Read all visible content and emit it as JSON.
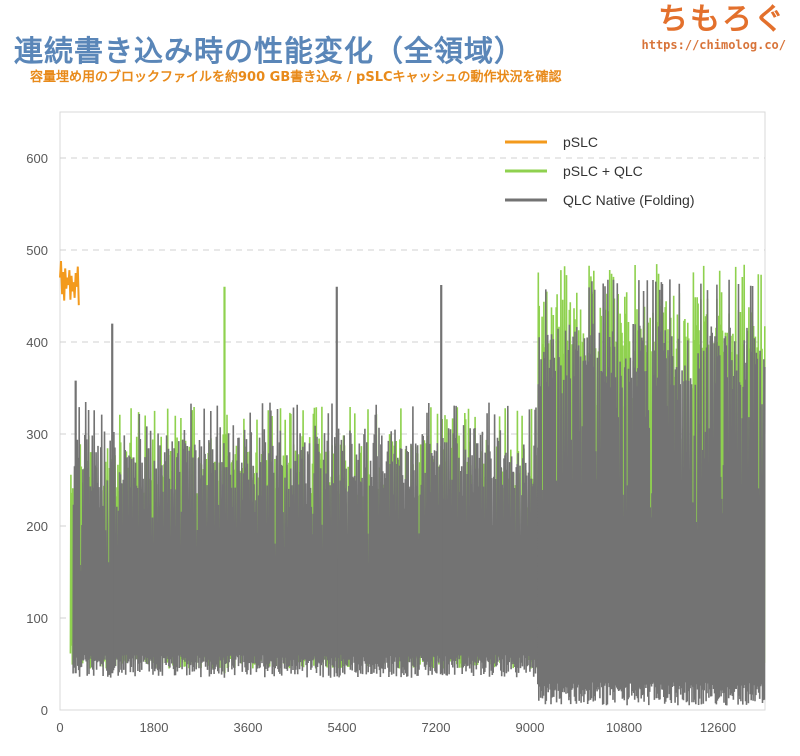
{
  "header": {
    "title": "連続書き込み時の性能変化（全領域）",
    "subtitle": "容量埋め用のブロックファイルを約900 GB書き込み / pSLCキャッシュの動作状況を確認",
    "brand_name": "ちもろぐ",
    "brand_url": "https://chimolog.co/"
  },
  "chart_data": {
    "type": "line",
    "title": "連続書き込み時の性能変化（全領域）",
    "subtitle": "容量埋め用のブロックファイルを約900 GB書き込み / pSLCキャッシュの動作状況を確認",
    "xlabel": "",
    "ylabel": "",
    "xlim": [
      0,
      13500
    ],
    "ylim": [
      0,
      650
    ],
    "x_ticks": [
      0,
      1800,
      3600,
      5400,
      7200,
      9000,
      10800,
      12600
    ],
    "y_ticks": [
      0,
      100,
      200,
      300,
      400,
      500,
      600
    ],
    "grid": "horizontal dashed",
    "legend_position": "top-right",
    "colors": {
      "pslc": "#f39a1d",
      "pslc_qlc": "#8fd14f",
      "qlc_native": "#737373",
      "grid": "#d0d0d0",
      "axis_text": "#595959"
    },
    "series": [
      {
        "name": "pSLC",
        "color": "#f39a1d",
        "x": [
          0,
          20,
          40,
          60,
          80,
          100,
          120,
          140,
          160,
          180,
          200,
          220,
          240,
          260,
          280,
          300,
          320,
          340,
          360
        ],
        "values": [
          470,
          488,
          452,
          476,
          445,
          480,
          458,
          470,
          462,
          478,
          446,
          472,
          455,
          465,
          448,
          475,
          460,
          482,
          440
        ]
      },
      {
        "name": "pSLC + QLC",
        "color": "#8fd14f",
        "segments": [
          {
            "x_start": 200,
            "x_end": 9150,
            "min": 45,
            "typical_high": 300,
            "max": 330
          },
          {
            "x_start": 9150,
            "x_end": 13500,
            "min": 35,
            "typical_high": 455,
            "max": 485
          }
        ],
        "peaks": [
          {
            "x": 3150,
            "y": 460
          }
        ]
      },
      {
        "name": "QLC Native (Folding)",
        "color": "#737373",
        "segments": [
          {
            "x_start": 250,
            "x_end": 9150,
            "min": 35,
            "typical_high": 310,
            "max": 335
          },
          {
            "x_start": 9150,
            "x_end": 13500,
            "min": 5,
            "typical_high": 420,
            "max": 470
          }
        ],
        "peaks": [
          {
            "x": 300,
            "y": 358
          },
          {
            "x": 1000,
            "y": 420
          },
          {
            "x": 5300,
            "y": 460
          },
          {
            "x": 7300,
            "y": 462
          }
        ]
      }
    ]
  }
}
